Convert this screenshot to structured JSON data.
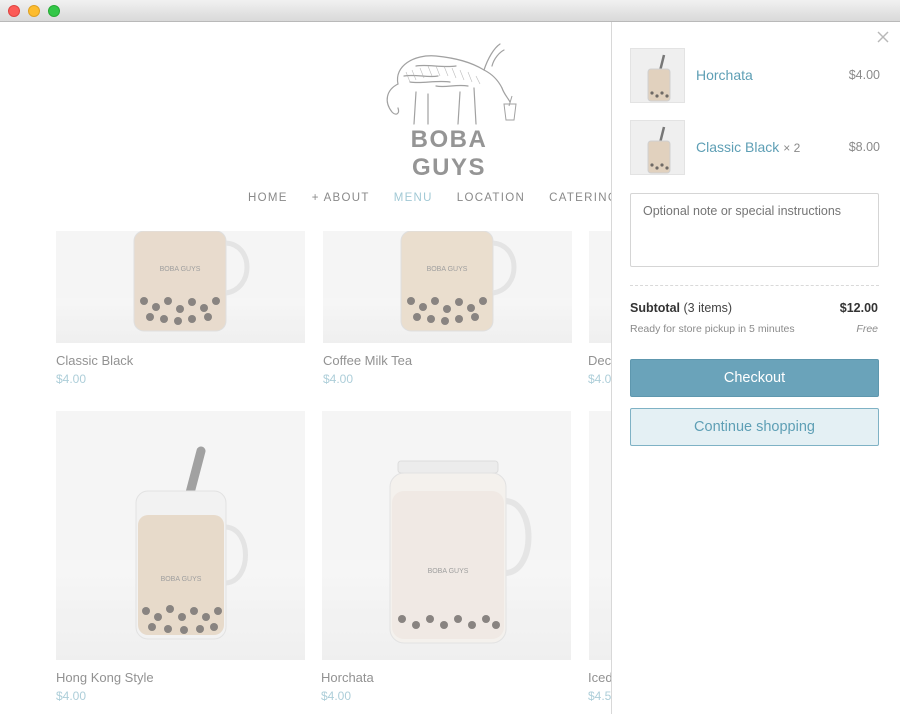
{
  "store": {
    "brand": "BOBA GUYS",
    "nav": [
      {
        "label": "HOME",
        "active": false
      },
      {
        "label": "+ ABOUT",
        "active": false
      },
      {
        "label": "MENU",
        "active": true
      },
      {
        "label": "LOCATION",
        "active": false
      },
      {
        "label": "CATERING",
        "active": false
      }
    ],
    "products": [
      {
        "name": "Classic Black",
        "price": "$4.00"
      },
      {
        "name": "Coffee Milk Tea",
        "price": "$4.00"
      },
      {
        "name": "Deca",
        "price": "$4.0"
      },
      {
        "name": "Hong Kong Style",
        "price": "$4.00"
      },
      {
        "name": "Horchata",
        "price": "$4.00"
      },
      {
        "name": "Iced",
        "price": "$4.5"
      }
    ]
  },
  "cart": {
    "items": [
      {
        "name": "Horchata",
        "qty": "",
        "price": "$4.00"
      },
      {
        "name": "Classic Black",
        "qty": "× 2",
        "price": "$8.00"
      }
    ],
    "note_placeholder": "Optional note or special instructions",
    "subtotal_label": "Subtotal",
    "subtotal_count": "(3 items)",
    "subtotal_value": "$12.00",
    "pickup_text": "Ready for store pickup in 5 minutes",
    "pickup_cost": "Free",
    "checkout_label": "Checkout",
    "continue_label": "Continue shopping"
  },
  "colors": {
    "accent": "#6aa3ba",
    "link": "#5e9fb5",
    "price": "#9cc4d1",
    "nav_active": "#8dbdcc"
  },
  "icons": {
    "close": "close-icon",
    "logo": "aardvark-logo-icon"
  }
}
